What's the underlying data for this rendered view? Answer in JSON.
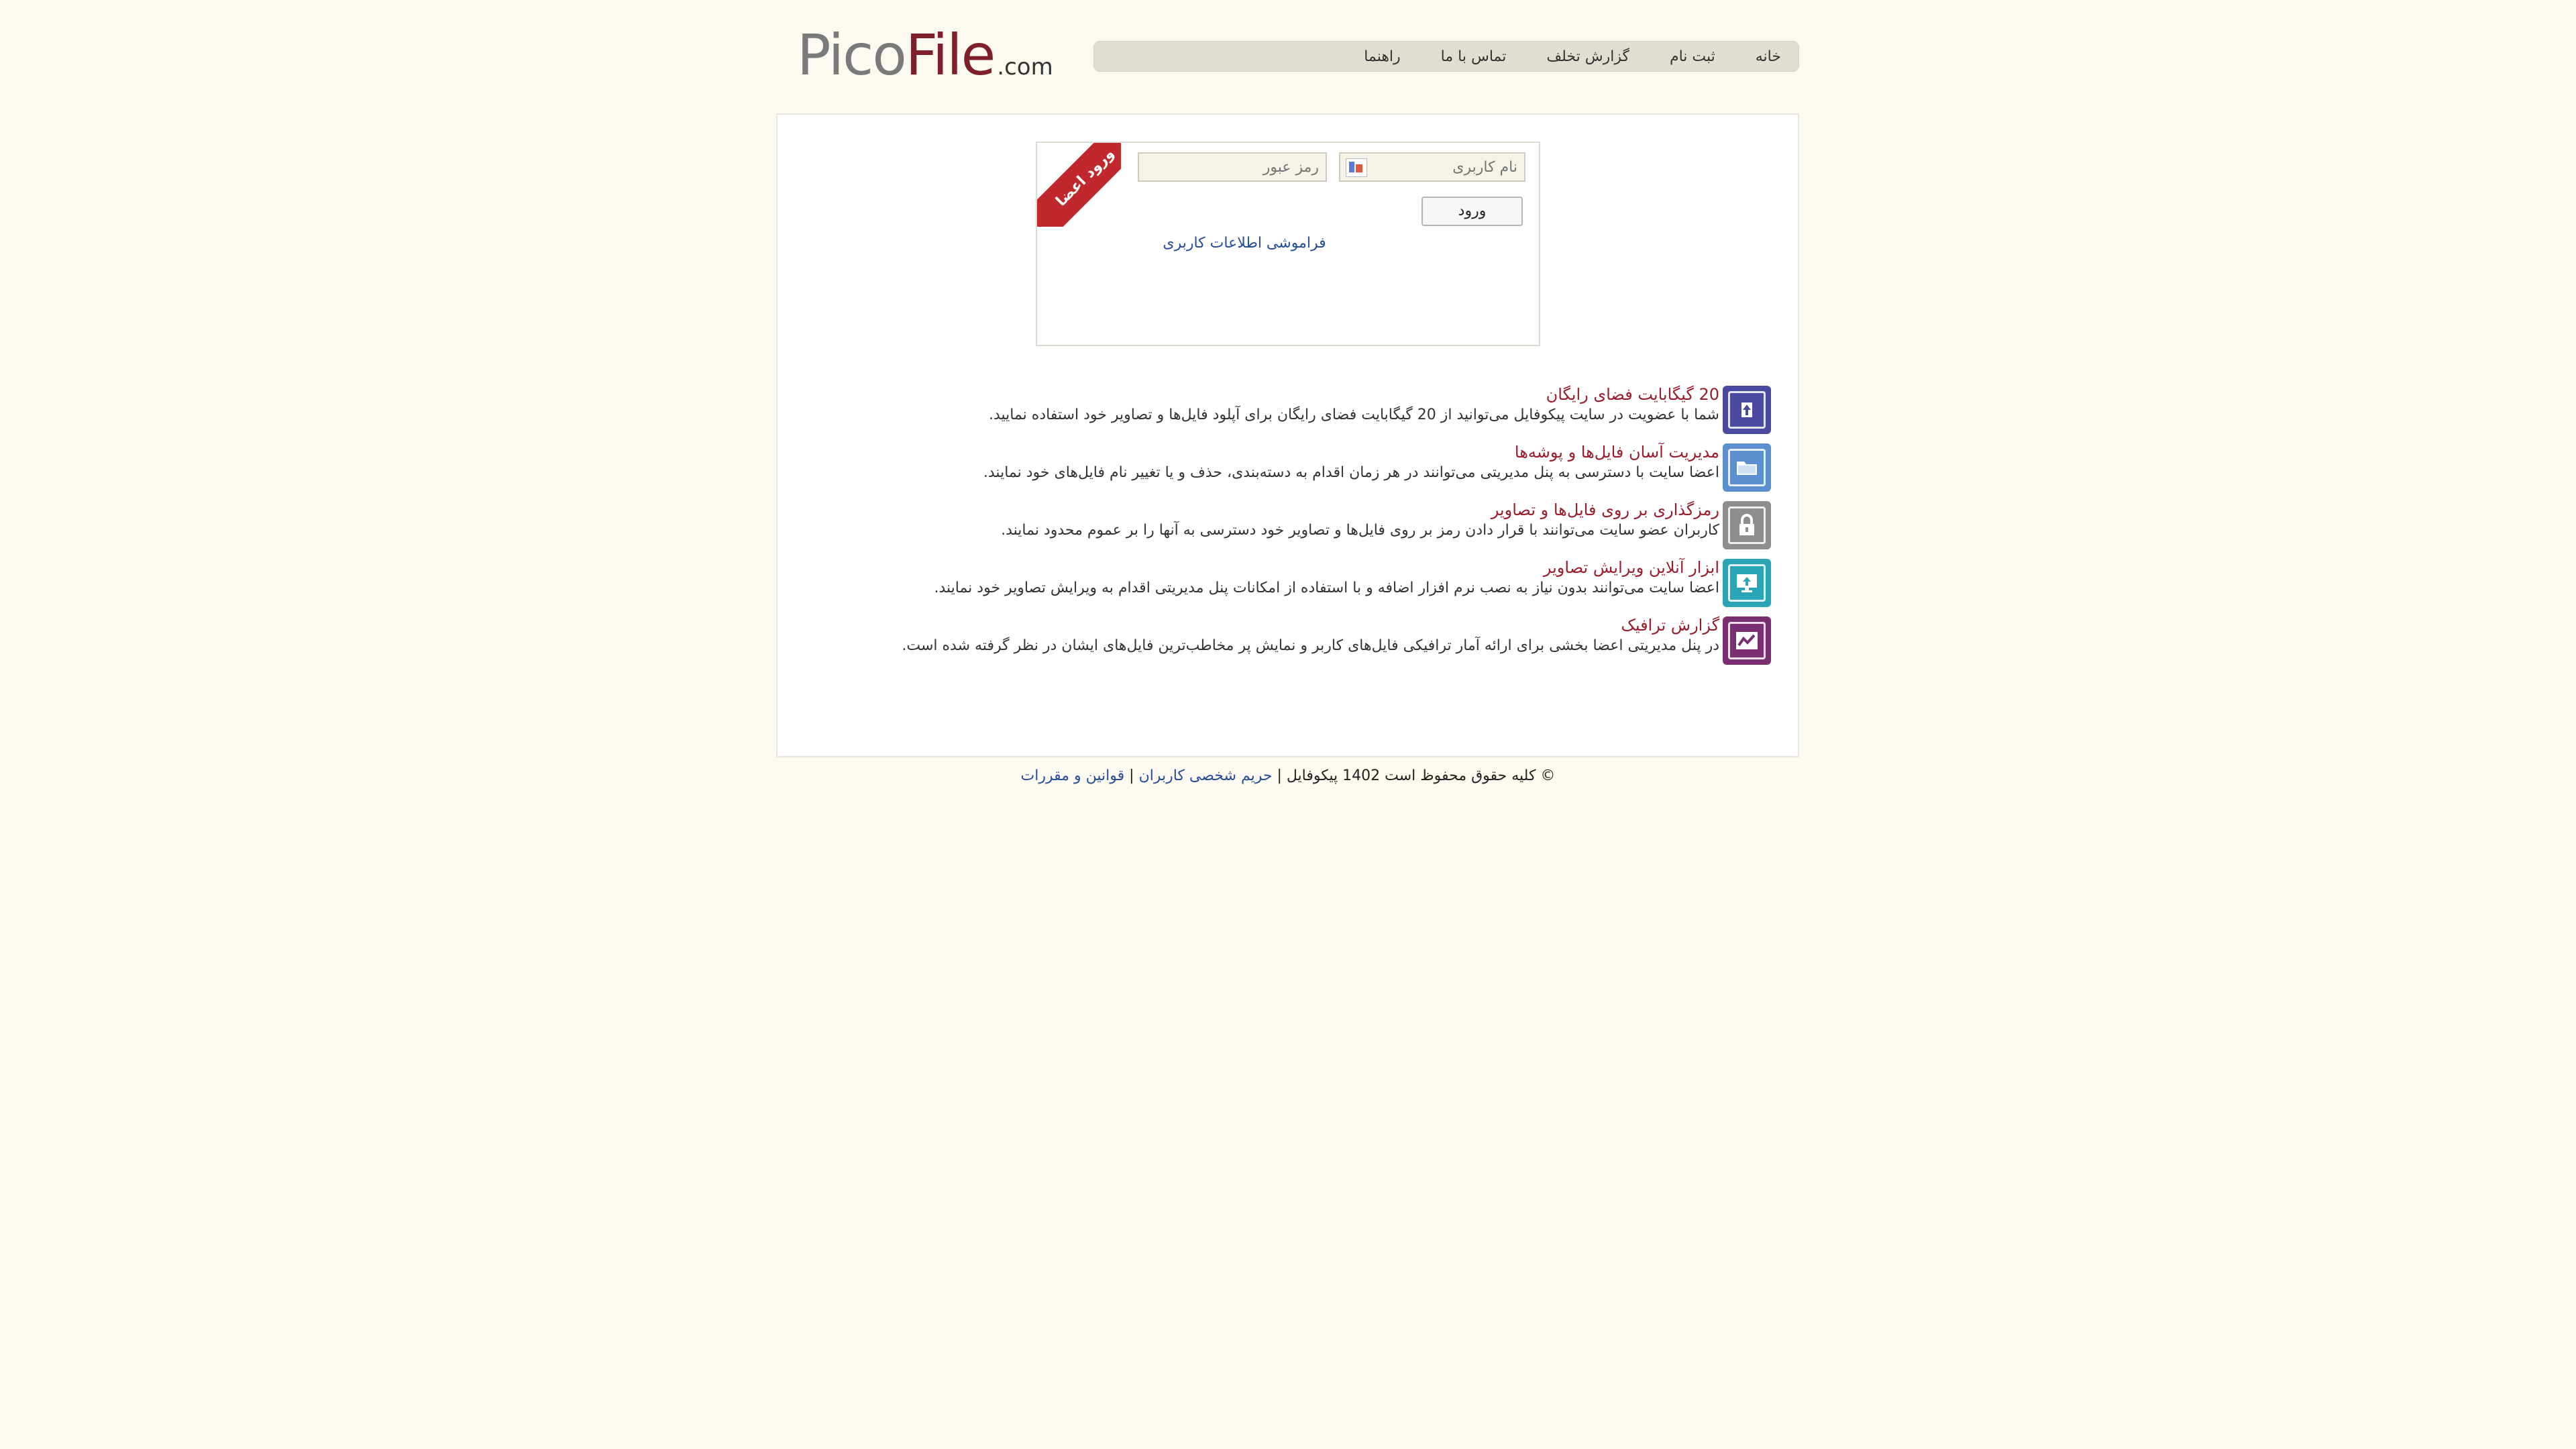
{
  "logo": {
    "pico": "Pico",
    "file": "File",
    "dotcom": ".com"
  },
  "nav": [
    {
      "label": "خانه"
    },
    {
      "label": "ثبت نام"
    },
    {
      "label": "گزارش تخلف"
    },
    {
      "label": "تماس با ما"
    },
    {
      "label": "راهنما"
    }
  ],
  "login": {
    "ribbon_label": "ورود اعضا",
    "username_placeholder": "نام کاربری",
    "password_placeholder": "رمز عبور",
    "submit_label": "ورود",
    "forgot_label": "فراموشی اطلاعات کاربری"
  },
  "features": [
    {
      "title": "20 گیگابایت فضای رایگان",
      "desc": "شما با عضویت در سایت پیکوفایل می‌توانید از 20 گیگابایت فضای رایگان برای آپلود فایل‌ها و تصاویر خود استفاده نمایید.",
      "icon": "upload-icon",
      "color": "#4a4aa0"
    },
    {
      "title": "مدیریت آسان فایل‌ها و پوشه‌ها",
      "desc": "اعضا سایت با دسترسی به پنل مدیریتی می‌توانند در هر زمان اقدام به دسته‌بندی، حذف و یا تغییر نام فایل‌های خود نمایند.",
      "icon": "folder-icon",
      "color": "#5b8fcf"
    },
    {
      "title": "رمزگذاری بر روی فایل‌ها و تصاویر",
      "desc": "کاربران عضو سایت می‌توانند با قرار دادن رمز بر روی فایل‌ها و تصاویر خود دسترسی به آنها را بر عموم محدود نمایند.",
      "icon": "lock-icon",
      "color": "#8e8e8e"
    },
    {
      "title": "ابزار آنلاین ویرایش تصاویر",
      "desc": "اعضا سایت می‌توانند بدون نیاز به نصب نرم افزار اضافه و با استفاده از امکانات پنل مدیریتی اقدام به ویرایش تصاویر خود نمایند.",
      "icon": "monitor-icon",
      "color": "#2aa5b5"
    },
    {
      "title": "گزارش ترافیک",
      "desc": "در پنل مدیریتی اعضا بخشی برای ارائه آمار ترافیکی فایل‌های کاربر و نمایش پر مخاطب‌ترین فایل‌های ایشان در نظر گرفته شده است.",
      "icon": "traffic-chart-icon",
      "color": "#7a2f73"
    }
  ],
  "footer": {
    "copyright": "© کلیه حقوق محفوظ است 1402 پیکوفایل",
    "separator": " | ",
    "privacy_label": "حریم شخصی کاربران",
    "rules_label": "قوانین و مقررات"
  }
}
